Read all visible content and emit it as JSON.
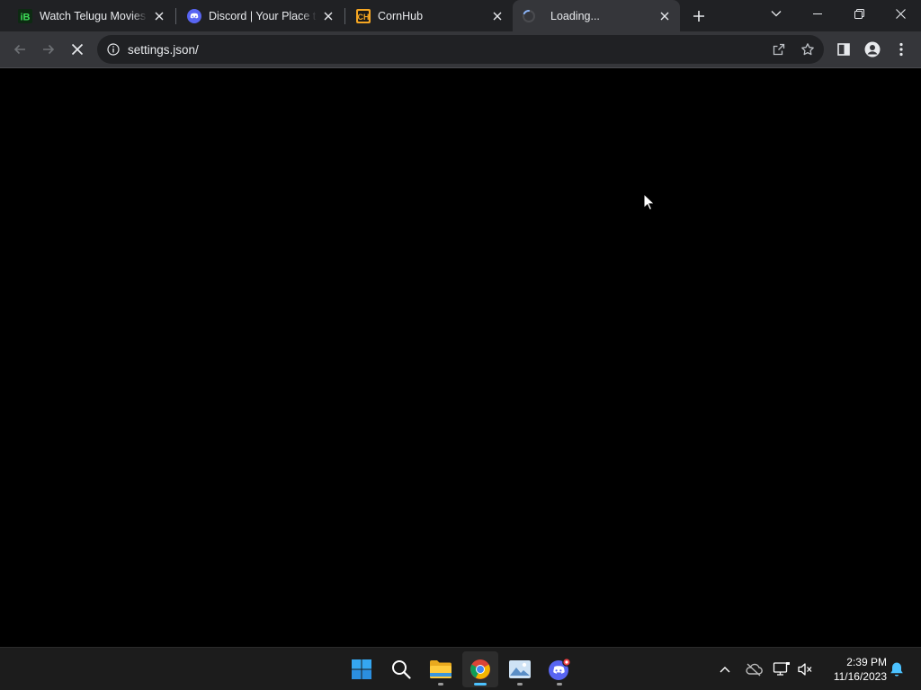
{
  "tabs": [
    {
      "title": "Watch Telugu Movies Online",
      "favicon": "ibomma-icon",
      "active": false
    },
    {
      "title": "Discord | Your Place to Talk and Hang Out",
      "favicon": "discord-icon",
      "active": false
    },
    {
      "title": "CornHub",
      "favicon": "cornhub-icon",
      "active": false
    },
    {
      "title": "Loading...",
      "favicon": "loading-spinner-icon",
      "active": true
    }
  ],
  "toolbar": {
    "url": "settings.json/"
  },
  "taskbar": {
    "apps": [
      "start-icon",
      "search-icon",
      "file-explorer-icon",
      "chrome-icon",
      "photos-icon",
      "discord-icon"
    ],
    "time": "2:39 PM",
    "date": "11/16/2023"
  },
  "colors": {
    "tabstrip": "#202124",
    "toolbar": "#35363a",
    "omnibox": "#202124",
    "page": "#000000",
    "taskbar": "#1c1c1c",
    "accent": "#4cc2ff",
    "discord": "#5865f2",
    "cornhub": "#f5a623"
  }
}
